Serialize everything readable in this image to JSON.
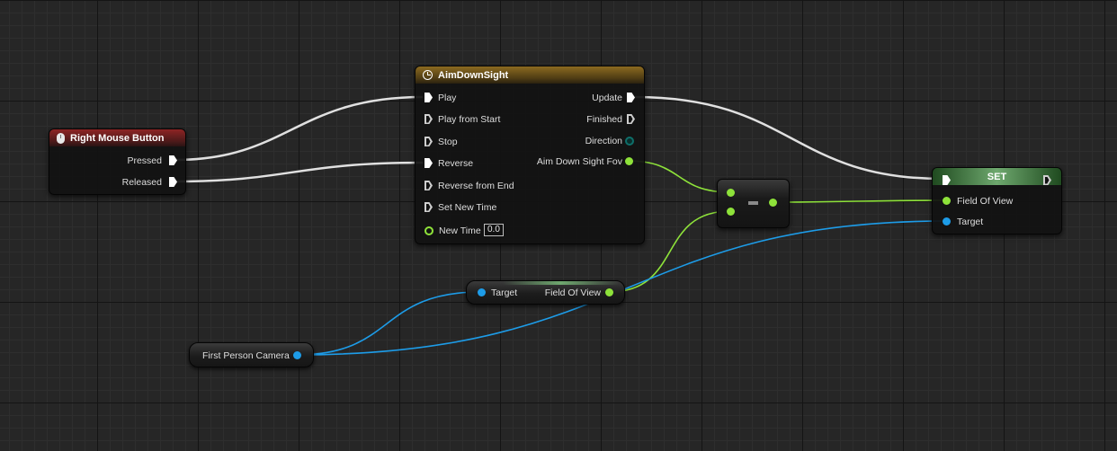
{
  "colors": {
    "exec_wire": "#e0e0e0",
    "float_wire": "#8ee23a",
    "object_wire": "#1d9ce8"
  },
  "right_mouse_button": {
    "title": "Right Mouse Button",
    "icon": "mouse-icon",
    "pins": {
      "pressed": "Pressed",
      "released": "Released"
    }
  },
  "timeline": {
    "title": "AimDownSight",
    "icon": "clock-icon",
    "inputs": {
      "play": "Play",
      "play_from_start": "Play from Start",
      "stop": "Stop",
      "reverse": "Reverse",
      "reverse_from_end": "Reverse from End",
      "set_new_time": "Set New Time",
      "new_time": "New Time",
      "new_time_value": "0.0"
    },
    "outputs": {
      "update": "Update",
      "finished": "Finished",
      "direction": "Direction",
      "aim_down_sight_fov": "Aim Down Sight Fov"
    }
  },
  "set_node": {
    "title": "SET",
    "pins": {
      "field_of_view": "Field Of View",
      "target": "Target"
    }
  },
  "get_fov_node": {
    "pins": {
      "target": "Target",
      "field_of_view": "Field Of View"
    }
  },
  "camera_node": {
    "label": "First Person Camera"
  }
}
